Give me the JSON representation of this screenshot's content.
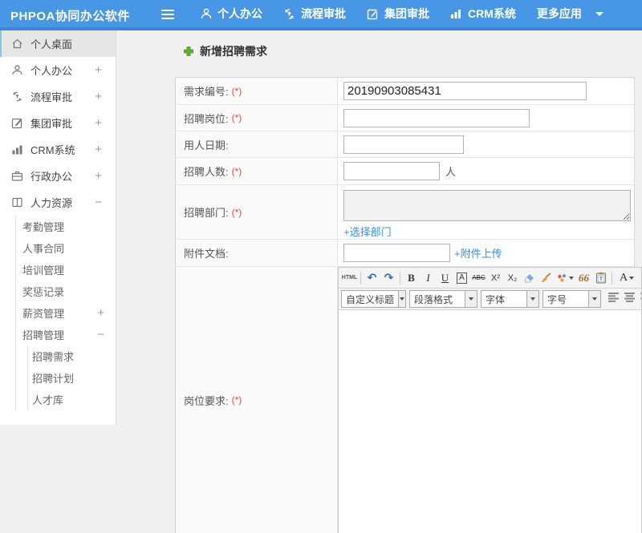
{
  "theme": {
    "header_blue": "#4897e7",
    "header_blue_dark": "#3a86d8",
    "link_blue": "#3a8ede",
    "required_red": "#e54545",
    "plus_green": "#5cb32e"
  },
  "header": {
    "logo": "PHPOA协同办公软件",
    "nav": [
      {
        "label": "个人办公",
        "icon": "person-icon"
      },
      {
        "label": "流程审批",
        "icon": "process-icon"
      },
      {
        "label": "集团审批",
        "icon": "edit-icon"
      },
      {
        "label": "CRM系统",
        "icon": "bar-chart-icon"
      },
      {
        "label": "更多应用",
        "icon": "caret-down-icon"
      }
    ]
  },
  "sidebar": {
    "items": [
      {
        "label": "个人桌面",
        "expander": "",
        "icon": "home-icon",
        "active": true
      },
      {
        "label": "个人办公",
        "expander": "+",
        "icon": "person-icon"
      },
      {
        "label": "流程审批",
        "expander": "+",
        "icon": "process-icon"
      },
      {
        "label": "集团审批",
        "expander": "+",
        "icon": "edit-icon"
      },
      {
        "label": "CRM系统",
        "expander": "+",
        "icon": "bar-chart-icon"
      },
      {
        "label": "行政办公",
        "expander": "+",
        "icon": "briefcase-icon"
      },
      {
        "label": "人力资源",
        "expander": "−",
        "icon": "book-icon"
      }
    ],
    "hr_submenu": [
      {
        "label": "考勤管理",
        "expander": ""
      },
      {
        "label": "人事合同",
        "expander": ""
      },
      {
        "label": "培训管理",
        "expander": ""
      },
      {
        "label": "奖惩记录",
        "expander": ""
      },
      {
        "label": "薪资管理",
        "expander": "+"
      },
      {
        "label": "招聘管理",
        "expander": "−"
      }
    ],
    "recruit_submenu": [
      {
        "label": "招聘需求"
      },
      {
        "label": "招聘计划"
      },
      {
        "label": "人才库"
      }
    ]
  },
  "main": {
    "title": "新增招聘需求",
    "required_marker": "(*)",
    "form": {
      "req_no": {
        "label": "需求编号:",
        "required": true,
        "value": "20190903085431"
      },
      "position": {
        "label": "招聘岗位:",
        "required": true,
        "value": ""
      },
      "date": {
        "label": "用人日期:",
        "required": false,
        "value": ""
      },
      "headcount": {
        "label": "招聘人数:",
        "required": true,
        "value": "",
        "suffix": "人"
      },
      "dept": {
        "label": "招聘部门:",
        "required": true,
        "value": "",
        "link": "+选择部门"
      },
      "attachment": {
        "label": "附件文档:",
        "required": false,
        "value": "",
        "link": "+附件上传"
      },
      "requirement": {
        "label": "岗位要求:",
        "required": true
      }
    }
  },
  "editor": {
    "toolbar": {
      "html": "HTML",
      "undo": "↶",
      "redo": "↷",
      "bold": "B",
      "italic": "I",
      "underline": "U",
      "removeformat": "A",
      "strikethrough": "ABC",
      "superscript": "X²",
      "subscript": "X₂",
      "quote": "66",
      "paste_letter": "T",
      "fontcolor": "A",
      "hilite": "a"
    },
    "dropdowns": [
      {
        "label": "自定义标题"
      },
      {
        "label": "段落格式"
      },
      {
        "label": "字体"
      },
      {
        "label": "字号"
      }
    ]
  }
}
